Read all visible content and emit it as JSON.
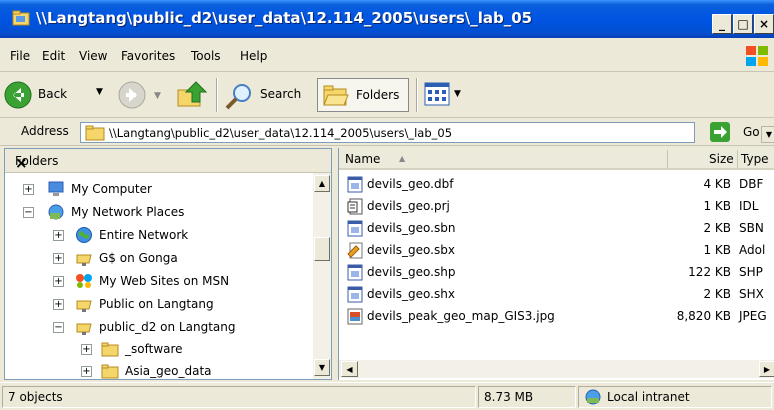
{
  "window": {
    "title": "\\\\Langtang\\public_d2\\user_data\\12.114_2005\\users\\_lab_05",
    "minimize": "_",
    "maximize": "□",
    "close": "×"
  },
  "menu": [
    {
      "label": "File"
    },
    {
      "label": "Edit"
    },
    {
      "label": "View"
    },
    {
      "label": "Favorites"
    },
    {
      "label": "Tools"
    },
    {
      "label": "Help"
    }
  ],
  "toolbar": {
    "back_label": "Back",
    "search_label": "Search",
    "folders_label": "Folders"
  },
  "address": {
    "label": "Address",
    "value": "\\\\Langtang\\public_d2\\user_data\\12.114_2005\\users\\_lab_05",
    "go_label": "Go"
  },
  "folders_pane": {
    "title": "Folders",
    "close": "×",
    "tree": [
      {
        "label": "My Computer",
        "icon": "computer-icon",
        "toggle": "+"
      },
      {
        "label": "My Network Places",
        "icon": "network-places-icon",
        "toggle": "−"
      },
      {
        "label": "Entire Network",
        "icon": "globe-icon",
        "toggle": "+"
      },
      {
        "label": "G$ on Gonga",
        "icon": "network-drive-icon",
        "toggle": "+"
      },
      {
        "label": "My Web Sites on MSN",
        "icon": "msn-butterfly-icon",
        "toggle": "+"
      },
      {
        "label": "Public on Langtang",
        "icon": "network-drive-icon",
        "toggle": "+"
      },
      {
        "label": "public_d2 on Langtang",
        "icon": "network-drive-icon",
        "toggle": "−"
      },
      {
        "label": "_software",
        "icon": "folder-icon",
        "toggle": "+"
      },
      {
        "label": "Asia_geo_data",
        "icon": "folder-icon",
        "toggle": "+"
      }
    ]
  },
  "file_list": {
    "columns": {
      "name": "Name",
      "size": "Size",
      "type": "Type"
    },
    "sort_indicator": "▲",
    "rows": [
      {
        "name": "devils_geo.dbf",
        "size": "4 KB",
        "type": "DBF",
        "icon": "data-file-icon"
      },
      {
        "name": "devils_geo.prj",
        "size": "1 KB",
        "type": "IDL",
        "icon": "document-icon"
      },
      {
        "name": "devils_geo.sbn",
        "size": "2 KB",
        "type": "SBN",
        "icon": "data-file-icon"
      },
      {
        "name": "devils_geo.sbx",
        "size": "1 KB",
        "type": "Adol",
        "icon": "acrobat-file-icon"
      },
      {
        "name": "devils_geo.shp",
        "size": "122 KB",
        "type": "SHP",
        "icon": "data-file-icon"
      },
      {
        "name": "devils_geo.shx",
        "size": "2 KB",
        "type": "SHX",
        "icon": "data-file-icon"
      },
      {
        "name": "devils_peak_geo_map_GIS3.jpg",
        "size": "8,820 KB",
        "type": "JPEG",
        "icon": "image-file-icon"
      }
    ]
  },
  "status": {
    "objects": "7 objects",
    "size": "8.73 MB",
    "zone": "Local intranet"
  },
  "colors": {
    "titlebar": "#0054e3",
    "window_face": "#ece9d8",
    "pane_border": "#7f9db9"
  }
}
